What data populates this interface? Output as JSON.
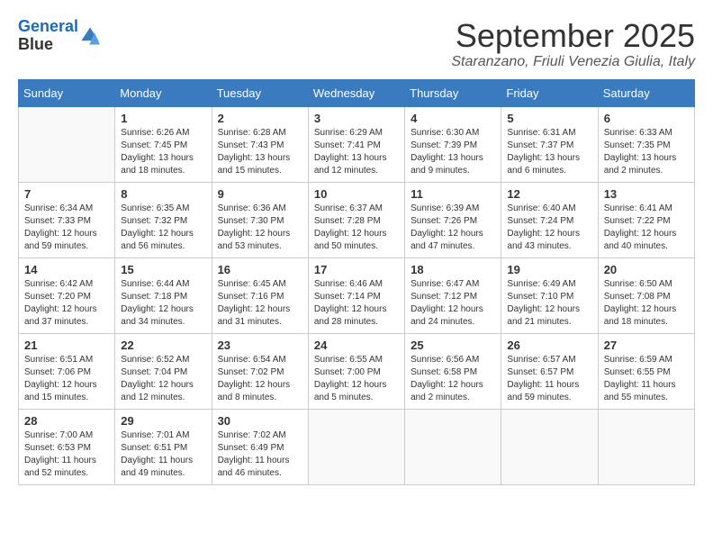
{
  "header": {
    "logo_line1": "General",
    "logo_line2": "Blue",
    "month_title": "September 2025",
    "location": "Staranzano, Friuli Venezia Giulia, Italy"
  },
  "weekdays": [
    "Sunday",
    "Monday",
    "Tuesday",
    "Wednesday",
    "Thursday",
    "Friday",
    "Saturday"
  ],
  "weeks": [
    [
      {
        "day": null
      },
      {
        "day": "1",
        "sunrise": "6:26 AM",
        "sunset": "7:45 PM",
        "daylight": "13 hours and 18 minutes."
      },
      {
        "day": "2",
        "sunrise": "6:28 AM",
        "sunset": "7:43 PM",
        "daylight": "13 hours and 15 minutes."
      },
      {
        "day": "3",
        "sunrise": "6:29 AM",
        "sunset": "7:41 PM",
        "daylight": "13 hours and 12 minutes."
      },
      {
        "day": "4",
        "sunrise": "6:30 AM",
        "sunset": "7:39 PM",
        "daylight": "13 hours and 9 minutes."
      },
      {
        "day": "5",
        "sunrise": "6:31 AM",
        "sunset": "7:37 PM",
        "daylight": "13 hours and 6 minutes."
      },
      {
        "day": "6",
        "sunrise": "6:33 AM",
        "sunset": "7:35 PM",
        "daylight": "13 hours and 2 minutes."
      }
    ],
    [
      {
        "day": "7",
        "sunrise": "6:34 AM",
        "sunset": "7:33 PM",
        "daylight": "12 hours and 59 minutes."
      },
      {
        "day": "8",
        "sunrise": "6:35 AM",
        "sunset": "7:32 PM",
        "daylight": "12 hours and 56 minutes."
      },
      {
        "day": "9",
        "sunrise": "6:36 AM",
        "sunset": "7:30 PM",
        "daylight": "12 hours and 53 minutes."
      },
      {
        "day": "10",
        "sunrise": "6:37 AM",
        "sunset": "7:28 PM",
        "daylight": "12 hours and 50 minutes."
      },
      {
        "day": "11",
        "sunrise": "6:39 AM",
        "sunset": "7:26 PM",
        "daylight": "12 hours and 47 minutes."
      },
      {
        "day": "12",
        "sunrise": "6:40 AM",
        "sunset": "7:24 PM",
        "daylight": "12 hours and 43 minutes."
      },
      {
        "day": "13",
        "sunrise": "6:41 AM",
        "sunset": "7:22 PM",
        "daylight": "12 hours and 40 minutes."
      }
    ],
    [
      {
        "day": "14",
        "sunrise": "6:42 AM",
        "sunset": "7:20 PM",
        "daylight": "12 hours and 37 minutes."
      },
      {
        "day": "15",
        "sunrise": "6:44 AM",
        "sunset": "7:18 PM",
        "daylight": "12 hours and 34 minutes."
      },
      {
        "day": "16",
        "sunrise": "6:45 AM",
        "sunset": "7:16 PM",
        "daylight": "12 hours and 31 minutes."
      },
      {
        "day": "17",
        "sunrise": "6:46 AM",
        "sunset": "7:14 PM",
        "daylight": "12 hours and 28 minutes."
      },
      {
        "day": "18",
        "sunrise": "6:47 AM",
        "sunset": "7:12 PM",
        "daylight": "12 hours and 24 minutes."
      },
      {
        "day": "19",
        "sunrise": "6:49 AM",
        "sunset": "7:10 PM",
        "daylight": "12 hours and 21 minutes."
      },
      {
        "day": "20",
        "sunrise": "6:50 AM",
        "sunset": "7:08 PM",
        "daylight": "12 hours and 18 minutes."
      }
    ],
    [
      {
        "day": "21",
        "sunrise": "6:51 AM",
        "sunset": "7:06 PM",
        "daylight": "12 hours and 15 minutes."
      },
      {
        "day": "22",
        "sunrise": "6:52 AM",
        "sunset": "7:04 PM",
        "daylight": "12 hours and 12 minutes."
      },
      {
        "day": "23",
        "sunrise": "6:54 AM",
        "sunset": "7:02 PM",
        "daylight": "12 hours and 8 minutes."
      },
      {
        "day": "24",
        "sunrise": "6:55 AM",
        "sunset": "7:00 PM",
        "daylight": "12 hours and 5 minutes."
      },
      {
        "day": "25",
        "sunrise": "6:56 AM",
        "sunset": "6:58 PM",
        "daylight": "12 hours and 2 minutes."
      },
      {
        "day": "26",
        "sunrise": "6:57 AM",
        "sunset": "6:57 PM",
        "daylight": "11 hours and 59 minutes."
      },
      {
        "day": "27",
        "sunrise": "6:59 AM",
        "sunset": "6:55 PM",
        "daylight": "11 hours and 55 minutes."
      }
    ],
    [
      {
        "day": "28",
        "sunrise": "7:00 AM",
        "sunset": "6:53 PM",
        "daylight": "11 hours and 52 minutes."
      },
      {
        "day": "29",
        "sunrise": "7:01 AM",
        "sunset": "6:51 PM",
        "daylight": "11 hours and 49 minutes."
      },
      {
        "day": "30",
        "sunrise": "7:02 AM",
        "sunset": "6:49 PM",
        "daylight": "11 hours and 46 minutes."
      },
      {
        "day": null
      },
      {
        "day": null
      },
      {
        "day": null
      },
      {
        "day": null
      }
    ]
  ],
  "labels": {
    "sunrise_label": "Sunrise:",
    "sunset_label": "Sunset:",
    "daylight_label": "Daylight:"
  }
}
